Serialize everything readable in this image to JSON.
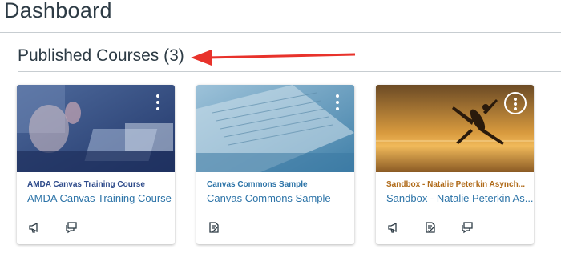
{
  "header": {
    "title": "Dashboard"
  },
  "section": {
    "title": "Published Courses (3)"
  },
  "cards": [
    {
      "code": "AMDA Canvas Training Course",
      "name": "AMDA Canvas Training Course",
      "color": "#2d4a8a",
      "icons": [
        "announcements-icon",
        "discussions-icon"
      ]
    },
    {
      "code": "Canvas Commons Sample",
      "name": "Canvas Commons Sample",
      "color": "#2d74a8",
      "icons": [
        "assignments-icon"
      ]
    },
    {
      "code": "Sandbox - Natalie Peterkin Asynch...",
      "name": "Sandbox - Natalie Peterkin As...",
      "color": "#b06b1a",
      "icons": [
        "announcements-icon",
        "assignments-icon",
        "discussions-icon"
      ]
    }
  ],
  "colors": {
    "link": "#2d74a8",
    "arrow": "#e8322b"
  }
}
